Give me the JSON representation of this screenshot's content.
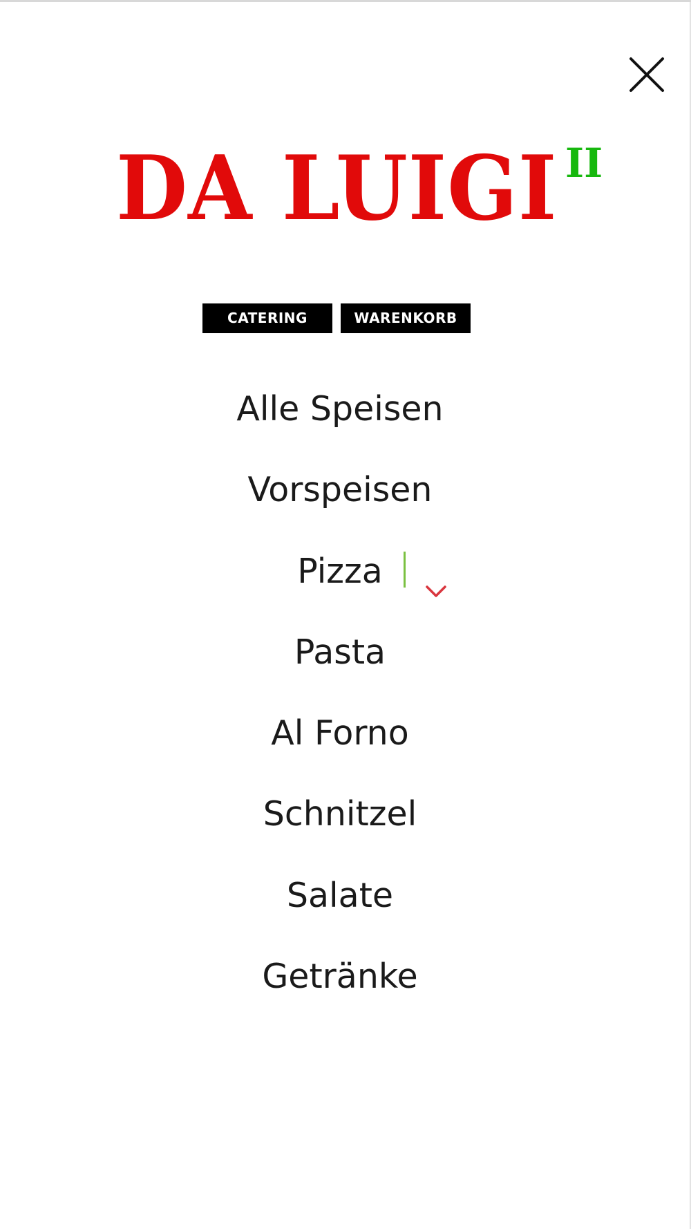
{
  "logo": {
    "main_text": "DA LUIGI",
    "superscript": "II",
    "main_color": "#e10a0a",
    "superscript_color": "#17b80e"
  },
  "header": {
    "close_icon": "close-icon",
    "catering_label": "CATERING",
    "cart_label": "WARENKORB"
  },
  "menu": {
    "items": [
      {
        "label": "Alle Speisen"
      },
      {
        "label": "Vorspeisen"
      },
      {
        "label": "Pizza",
        "has_submenu": true,
        "submenu_icon": "chevron-down-icon"
      },
      {
        "label": "Pasta"
      },
      {
        "label": "Al Forno"
      },
      {
        "label": "Schnitzel"
      },
      {
        "label": "Salate"
      },
      {
        "label": "Getränke"
      }
    ]
  },
  "colors": {
    "divider": "#7bc142",
    "chevron": "#d9363e",
    "button_bg": "#000000",
    "button_text": "#ffffff"
  }
}
